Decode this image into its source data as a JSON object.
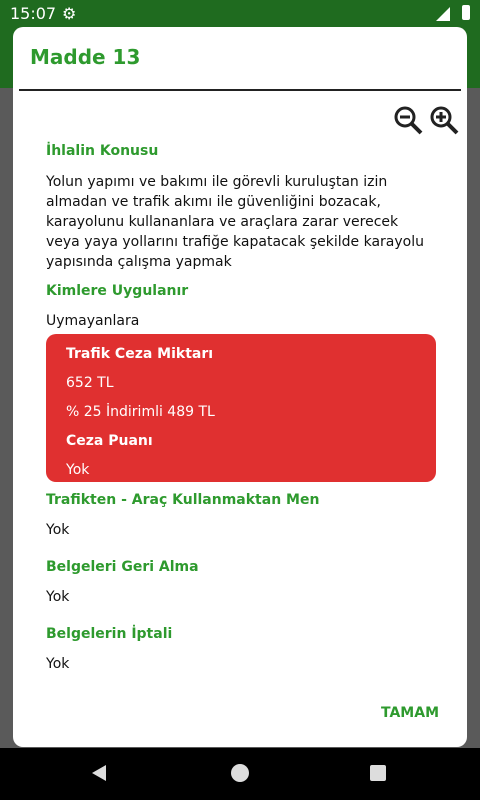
{
  "status_bar": {
    "time": "15:07"
  },
  "dialog": {
    "title": "Madde 13",
    "violation_heading": "İhlalin Konusu",
    "violation_text": "Yolun yapımı ve bakımı ile görevli kuruluştan izin almadan ve trafik akımı ile güvenliğini bozacak, karayolunu kullananlara ve araçlara zarar verecek veya yaya yollarını trafiğe kapatacak şekilde karayolu yapısında çalışma yapmak",
    "applies_heading": "Kimlere Uygulanır",
    "applies_value": "Uymayanlara",
    "penalty": {
      "fine_label": "Trafik Ceza Miktarı",
      "fine_amount": "652 TL",
      "fine_discounted": "% 25 İndirimli 489 TL",
      "points_label": "Ceza Puanı",
      "points_value": "Yok"
    },
    "ban_heading": "Trafikten - Araç Kullanmaktan Men",
    "ban_value": "Yok",
    "reclaim_heading": "Belgeleri Geri Alma",
    "reclaim_value": "Yok",
    "cancel_heading": "Belgelerin İptali",
    "cancel_value": "Yok",
    "ok_button": "TAMAM"
  },
  "icons": [
    "settings-icon",
    "signal-icon",
    "battery-icon",
    "zoom-out-icon",
    "zoom-in-icon",
    "nav-back-icon",
    "nav-home-icon",
    "nav-recents-icon"
  ],
  "colors": {
    "accent_green": "#2e9a2e",
    "app_bar_green": "#1f6b1f",
    "penalty_red": "#e03030"
  }
}
